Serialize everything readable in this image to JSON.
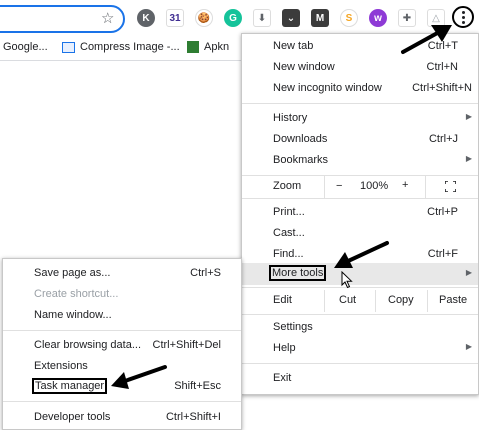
{
  "toolbar": {
    "bookmark_star_icon": "star-icon",
    "extensions": [
      {
        "name": "k-extension-icon",
        "glyph": "K",
        "bg": "#5f6368",
        "fg": "#ffffff",
        "shape": "circle"
      },
      {
        "name": "calendar-extension-icon",
        "glyph": "31",
        "bg": "#ffffff",
        "fg": "#3f2d91",
        "shape": "square"
      },
      {
        "name": "cookie-extension-icon",
        "glyph": "🍪",
        "bg": "#ffffff",
        "fg": "#8d5a2b",
        "shape": "circle"
      },
      {
        "name": "grammarly-extension-icon",
        "glyph": "G",
        "bg": "#15c39a",
        "fg": "#ffffff",
        "shape": "circle"
      },
      {
        "name": "download-extension-icon",
        "glyph": "⬇",
        "bg": "#ffffff",
        "fg": "#5f6368",
        "shape": "square"
      },
      {
        "name": "pocket-extension-icon",
        "glyph": "⌄",
        "bg": "#3c3c3c",
        "fg": "#ffffff",
        "shape": "square"
      },
      {
        "name": "m-extension-icon",
        "glyph": "M",
        "bg": "#3c3c3c",
        "fg": "#ffffff",
        "shape": "square"
      },
      {
        "name": "s-extension-icon",
        "glyph": "S",
        "bg": "#ffffff",
        "fg": "#f5a623",
        "shape": "circle"
      },
      {
        "name": "w-extension-icon",
        "glyph": "w",
        "bg": "#8e3ad6",
        "fg": "#ffffff",
        "shape": "circle"
      },
      {
        "name": "puzzle-extensions-icon",
        "glyph": "✚",
        "bg": "#ffffff",
        "fg": "#5f6368",
        "shape": "square"
      },
      {
        "name": "triangle-extension-icon",
        "glyph": "△",
        "bg": "#ffffff",
        "fg": "#9aa0a6",
        "shape": "square"
      }
    ],
    "menu_icon": "three-dots-menu-icon"
  },
  "bookmarks": [
    {
      "label": "Google...",
      "icon": "google-bookmark-icon",
      "color": "#9aa0a6"
    },
    {
      "label": "Compress Image -...",
      "icon": "compress-image-bookmark-icon",
      "color": "#1a73e8"
    },
    {
      "label": "Apkn",
      "icon": "apkn-bookmark-icon",
      "color": "#2e7d32"
    }
  ],
  "main_menu": {
    "items": [
      {
        "label": "New tab",
        "shortcut": "Ctrl+T"
      },
      {
        "label": "New window",
        "shortcut": "Ctrl+N"
      },
      {
        "label": "New incognito window",
        "shortcut": "Ctrl+Shift+N"
      },
      {
        "label": "History",
        "shortcut": ""
      },
      {
        "label": "Downloads",
        "shortcut": "Ctrl+J"
      },
      {
        "label": "Bookmarks",
        "shortcut": ""
      },
      {
        "label": "Print...",
        "shortcut": "Ctrl+P"
      },
      {
        "label": "Cast...",
        "shortcut": ""
      },
      {
        "label": "Find...",
        "shortcut": "Ctrl+F"
      },
      {
        "label": "More tools",
        "shortcut": ""
      },
      {
        "label": "Settings",
        "shortcut": ""
      },
      {
        "label": "Help",
        "shortcut": ""
      },
      {
        "label": "Exit",
        "shortcut": ""
      }
    ],
    "zoom": {
      "label": "Zoom",
      "minus": "−",
      "value": "100%",
      "plus": "+",
      "fullscreen_icon": "fullscreen-icon"
    },
    "edit": {
      "label": "Edit",
      "cut": "Cut",
      "copy": "Copy",
      "paste": "Paste"
    }
  },
  "more_tools_menu": {
    "items": [
      {
        "label": "Save page as...",
        "shortcut": "Ctrl+S",
        "disabled": false
      },
      {
        "label": "Create shortcut...",
        "shortcut": "",
        "disabled": true
      },
      {
        "label": "Name window...",
        "shortcut": "",
        "disabled": false
      },
      {
        "label": "Clear browsing data...",
        "shortcut": "Ctrl+Shift+Del",
        "disabled": false
      },
      {
        "label": "Extensions",
        "shortcut": "",
        "disabled": false
      },
      {
        "label": "Task manager",
        "shortcut": "Shift+Esc",
        "disabled": false
      },
      {
        "label": "Developer tools",
        "shortcut": "Ctrl+Shift+I",
        "disabled": false
      }
    ]
  },
  "colors": {
    "accent": "#1a73e8",
    "highlight": "#e8e8e8",
    "annotation": "#000000"
  }
}
